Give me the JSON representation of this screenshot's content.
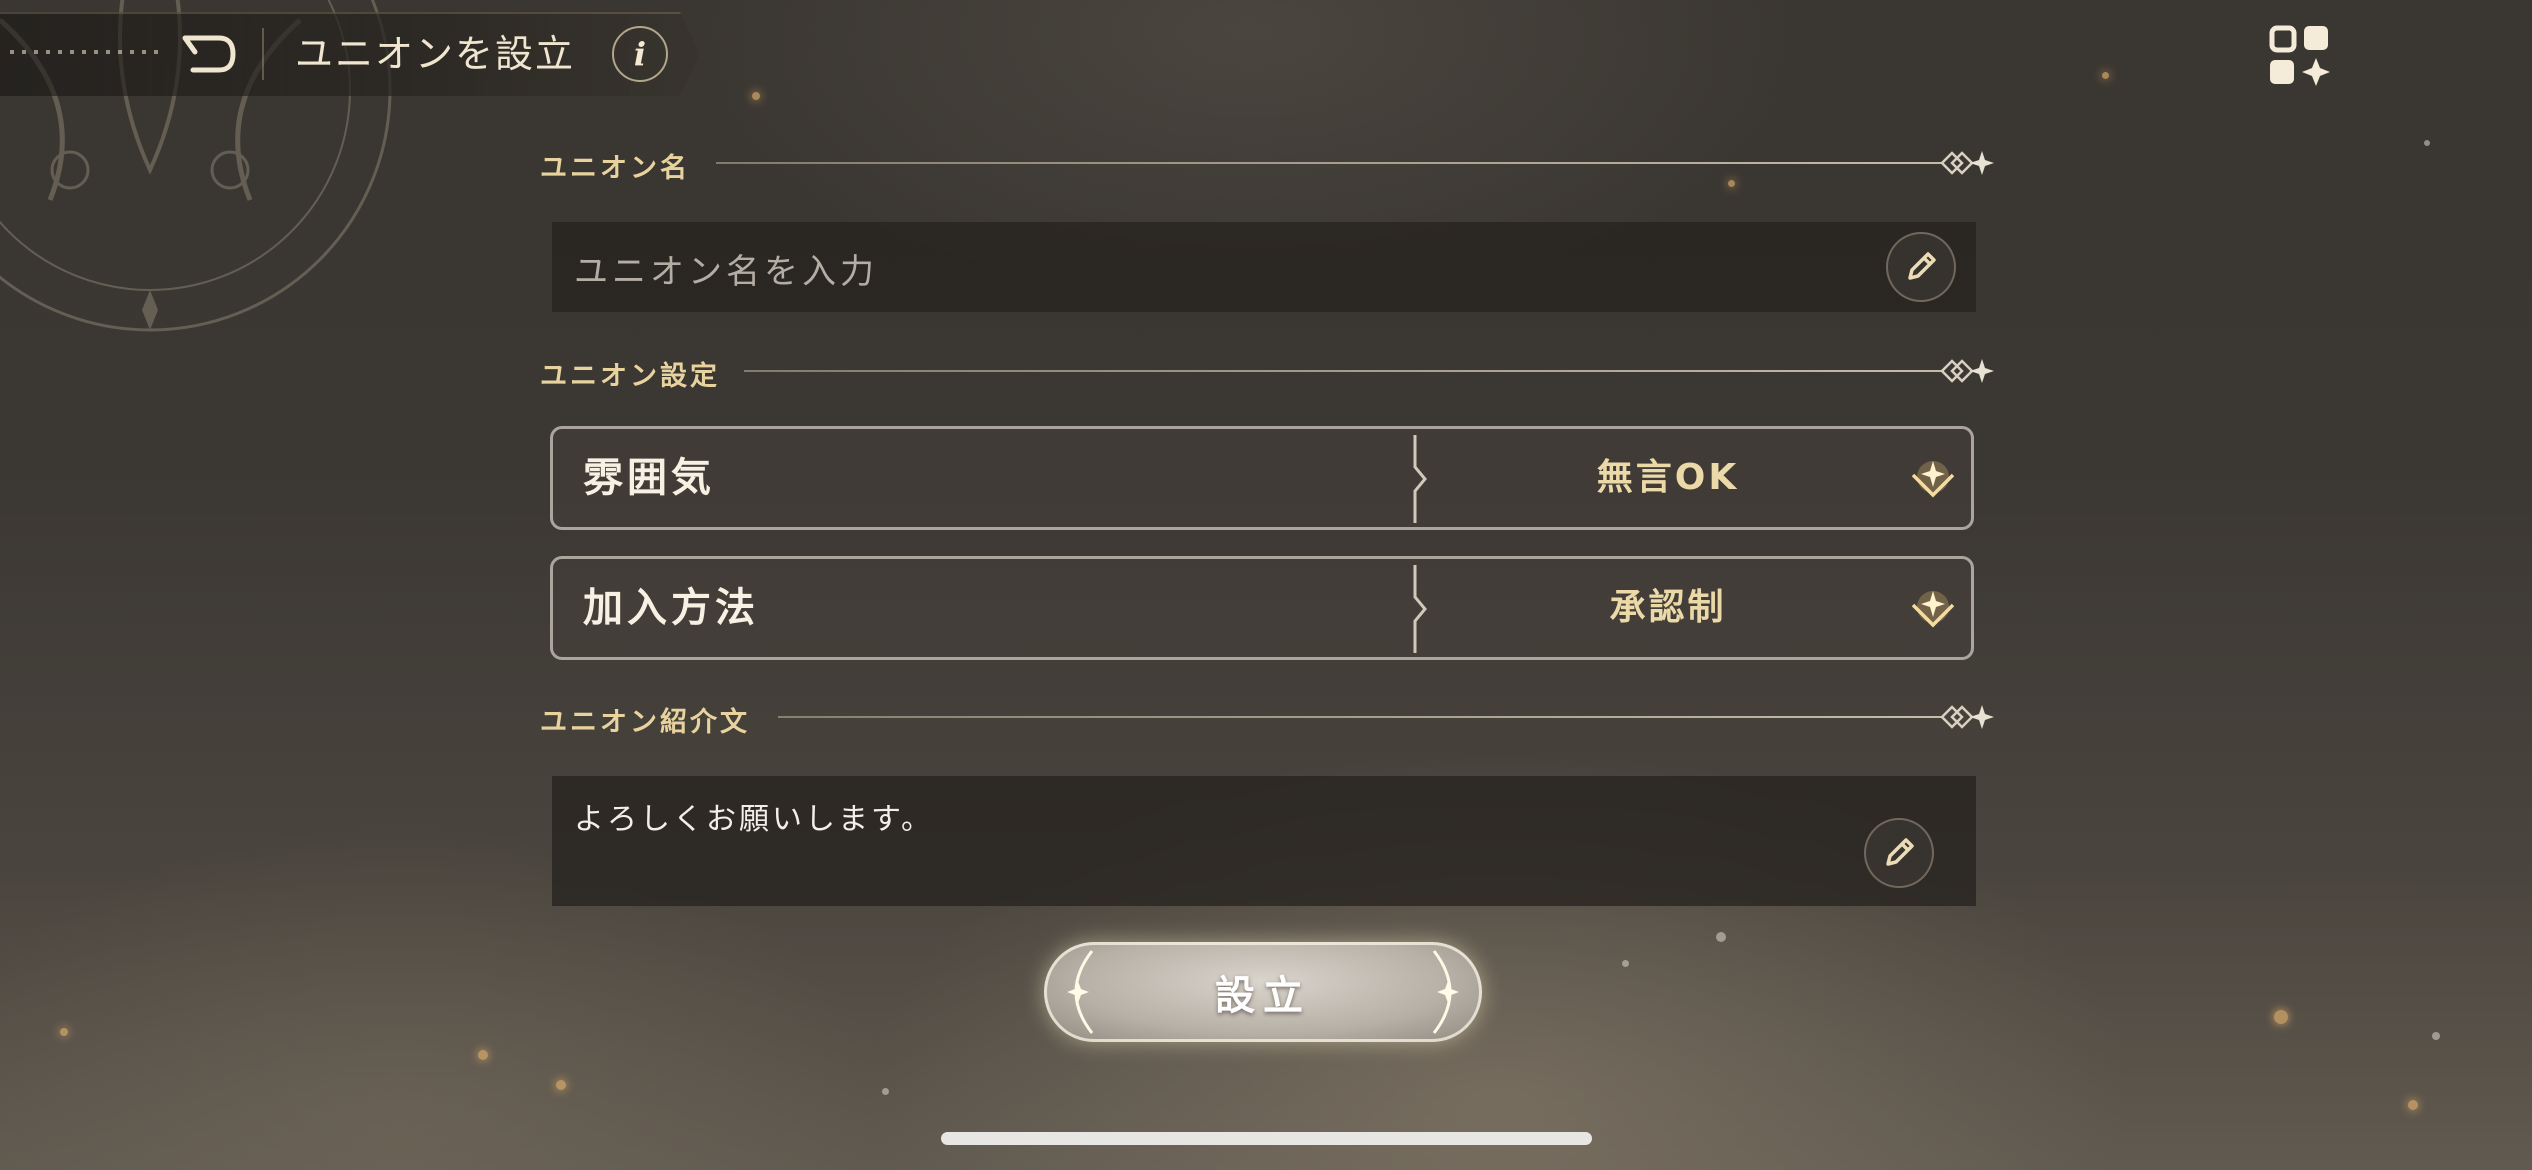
{
  "header": {
    "title": "ユニオンを設立",
    "info_label": "i"
  },
  "sections": {
    "name": {
      "label": "ユニオン名",
      "placeholder": "ユニオン名を入力"
    },
    "settings": {
      "label": "ユニオン設定",
      "rows": [
        {
          "label": "雰囲気",
          "value": "無言OK"
        },
        {
          "label": "加入方法",
          "value": "承認制"
        }
      ]
    },
    "intro": {
      "label": "ユニオン紹介文",
      "text": "よろしくお願いします。"
    }
  },
  "submit_label": "設立",
  "icons": [
    "back-icon",
    "info-icon",
    "menu-grid-icon",
    "pencil-icon",
    "dropdown-sparkle-icon"
  ],
  "colors": {
    "accent_gold": "#e8d39f",
    "value_gold": "#ecd9a8",
    "background": "#3b3733"
  }
}
